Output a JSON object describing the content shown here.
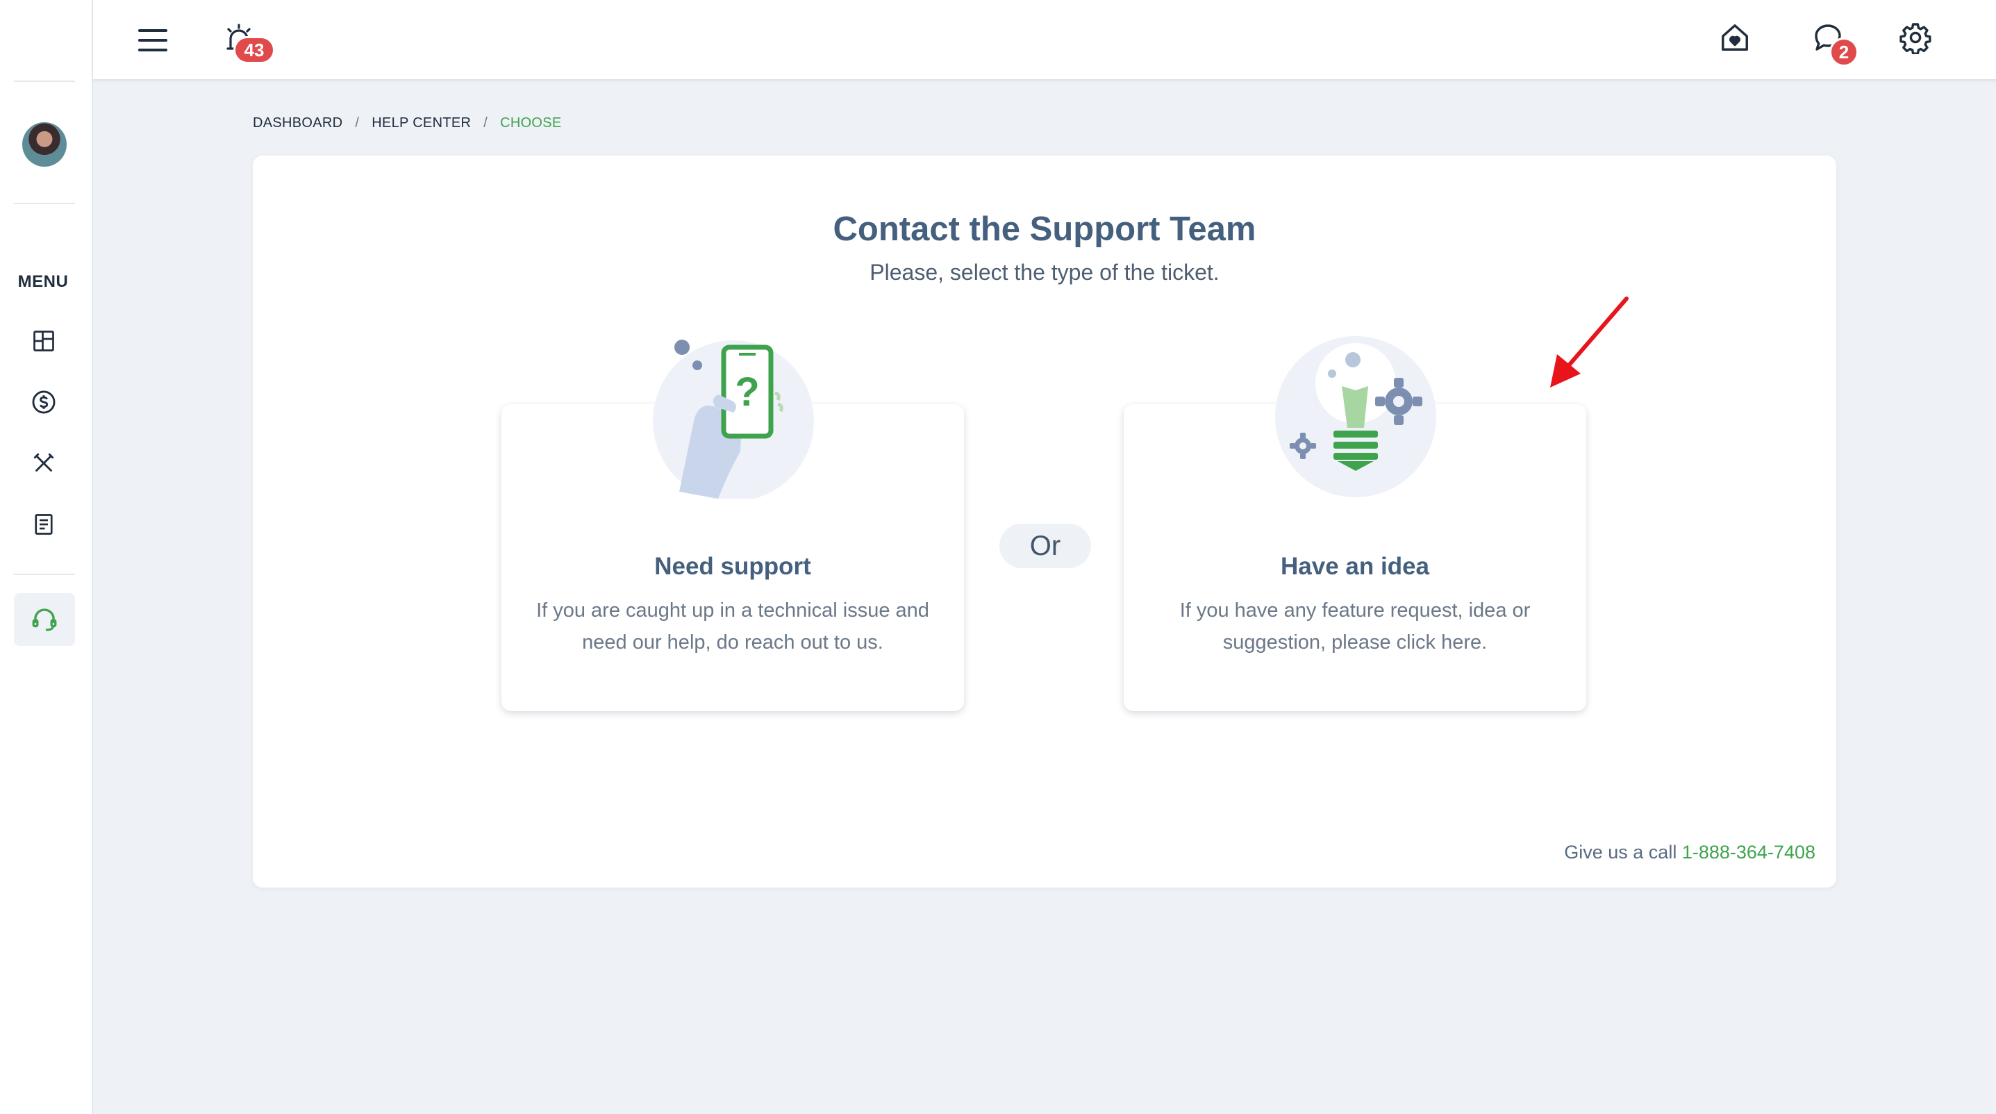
{
  "sidebar": {
    "menu_label": "MENU",
    "items": [
      {
        "icon": "dashboard-icon"
      },
      {
        "icon": "dollar-icon"
      },
      {
        "icon": "tools-icon"
      },
      {
        "icon": "document-icon"
      },
      {
        "icon": "headset-icon",
        "active": true
      }
    ]
  },
  "topbar": {
    "alarm_badge": "43",
    "chat_badge": "2"
  },
  "breadcrumb": {
    "items": [
      "DASHBOARD",
      "HELP CENTER"
    ],
    "separator": "/",
    "current": "CHOOSE"
  },
  "main": {
    "title": "Contact the Support Team",
    "subtitle": "Please, select the type of the ticket.",
    "or_label": "Or",
    "options": [
      {
        "title": "Need support",
        "description": "If you are caught up in a technical issue and need our help, do reach out to us."
      },
      {
        "title": "Have an idea",
        "description": "If you have any feature request, idea or suggestion, please click here."
      }
    ],
    "call_text": "Give us a call",
    "phone": "1-888-364-7408"
  },
  "colors": {
    "accent_green": "#3fa34d",
    "title_blue": "#44607e",
    "badge_red": "#e04a4a",
    "annotation_arrow": "#e8141b"
  }
}
